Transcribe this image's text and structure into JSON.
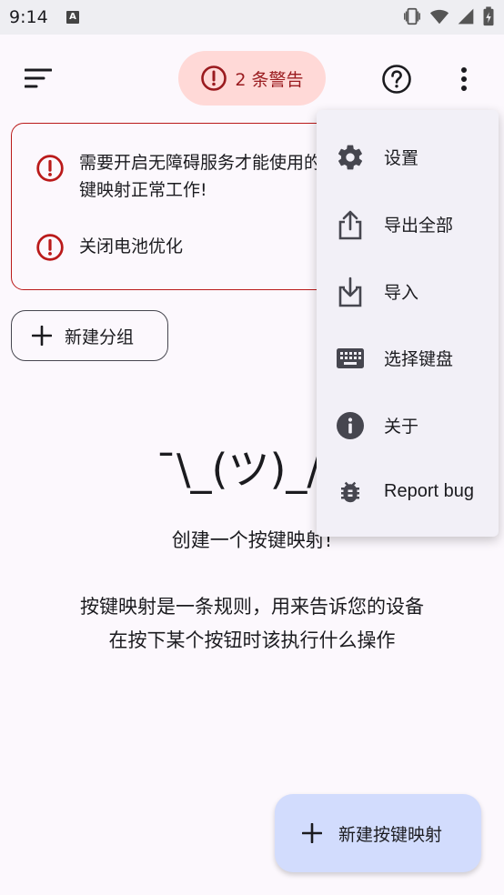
{
  "status_bar": {
    "time": "9:14",
    "notification_letter": "A"
  },
  "top_bar": {
    "warning_count_label": "2 条警告"
  },
  "warnings": [
    {
      "text": "需要开启无障碍服务才能使用的按键映射正常工作!"
    },
    {
      "text": "关闭电池优化"
    }
  ],
  "new_group_label": "新建分组",
  "empty_state": {
    "shrug": "¯\\_(ツ)_/¯",
    "title": "创建一个按键映射!",
    "description": "按键映射是一条规则，用来告诉您的设备在按下某个按钮时该执行什么操作"
  },
  "fab_label": "新建按键映射",
  "overflow_menu": {
    "items": [
      {
        "label": "设置",
        "icon": "gear-icon"
      },
      {
        "label": "导出全部",
        "icon": "export-icon"
      },
      {
        "label": "导入",
        "icon": "import-icon"
      },
      {
        "label": "选择键盘",
        "icon": "keyboard-icon"
      },
      {
        "label": "关于",
        "icon": "info-icon"
      },
      {
        "label": "Report bug",
        "icon": "bug-icon"
      }
    ]
  },
  "colors": {
    "background": "#FCF8FD",
    "warning_red": "#BA1A1A",
    "warning_pill_bg": "#FFD9D7",
    "fab_bg": "#D2DCFD",
    "menu_bg": "#F2F0F7"
  }
}
